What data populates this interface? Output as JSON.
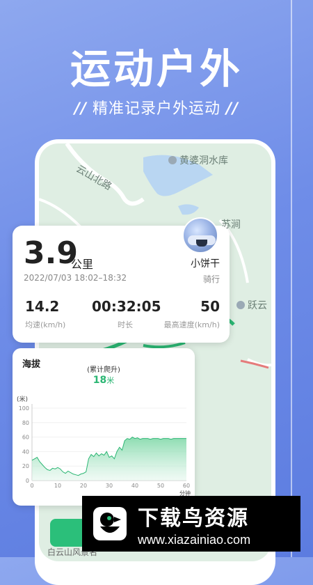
{
  "promo": {
    "title": "运动户外",
    "subtitle": "精准记录户外运动",
    "slash_left": "//",
    "slash_right": "//"
  },
  "map": {
    "labels": {
      "road": "云山北路",
      "reservoir": "黄婆洞水库",
      "place_a": "苏涧",
      "place_b": "跃云",
      "bottom_place": "白云山风景名"
    }
  },
  "summary": {
    "distance": "3.9",
    "distance_unit": "公里",
    "date_range": "2022/07/03 18:02–18:32",
    "username": "小饼干",
    "activity_type": "骑行",
    "avg_speed": {
      "value": "14.2",
      "label": "均速(km/h)"
    },
    "duration": {
      "value": "00:32:05",
      "label": "时长"
    },
    "max_speed": {
      "value": "50",
      "label": "最高速度(km/h)"
    }
  },
  "elevation": {
    "title": "海拔",
    "climb_label": "(累计爬升)",
    "climb_value": "18",
    "climb_unit": "米"
  },
  "chart_data": {
    "type": "area",
    "title": "",
    "xlabel": "分钟",
    "ylabel": "(米)",
    "xlim": [
      0,
      60
    ],
    "ylim": [
      0,
      100
    ],
    "x_ticks": [
      0,
      10,
      20,
      30,
      40,
      50,
      60
    ],
    "y_ticks": [
      0,
      20,
      40,
      60,
      80,
      100
    ],
    "color": "#2bb673",
    "series": [
      {
        "x": [
          0,
          1,
          2,
          3,
          4,
          5,
          6,
          7,
          8,
          9,
          10,
          11,
          12,
          13,
          14,
          15,
          16,
          17,
          18,
          19,
          20,
          21,
          22,
          23,
          24,
          25,
          26,
          27,
          28,
          29,
          30,
          31,
          32,
          33,
          34,
          35,
          36,
          37,
          38,
          39,
          40,
          41,
          42,
          43,
          44,
          45,
          46,
          47,
          48,
          49,
          50,
          51,
          52,
          53,
          54,
          55,
          56,
          57,
          58,
          59,
          60
        ],
        "y": [
          28,
          30,
          32,
          26,
          22,
          18,
          15,
          14,
          17,
          16,
          18,
          16,
          12,
          10,
          13,
          11,
          9,
          8,
          7,
          9,
          10,
          12,
          30,
          36,
          33,
          38,
          34,
          37,
          35,
          40,
          32,
          34,
          30,
          40,
          46,
          42,
          55,
          58,
          57,
          60,
          58,
          59,
          57,
          58,
          58,
          58,
          57,
          58,
          58,
          58,
          57,
          58,
          58,
          58,
          57,
          58,
          58,
          58,
          58,
          58,
          58
        ]
      }
    ]
  },
  "watermark": {
    "main": "下载鸟资源",
    "url": "www.xiazainiao.com"
  }
}
